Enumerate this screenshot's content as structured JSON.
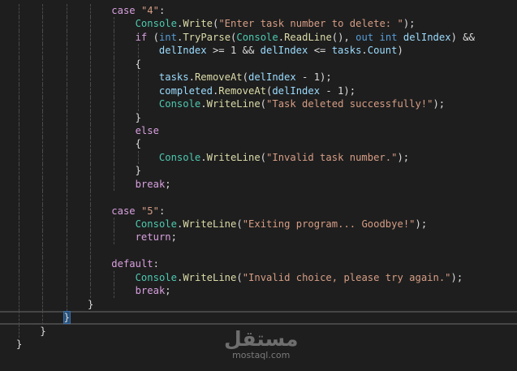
{
  "colors": {
    "background": "#1e1e1e",
    "keyword": "#d8a0df",
    "type_keyword": "#569cd6",
    "class": "#4ec9b0",
    "method": "#dcdcaa",
    "variable": "#9cdcfe",
    "string": "#d69d85"
  },
  "lines": [
    {
      "indent": 16,
      "tokens": [
        [
          "kw",
          "case"
        ],
        [
          "pun",
          " "
        ],
        [
          "str",
          "\"4\""
        ],
        [
          "pun",
          ":"
        ]
      ]
    },
    {
      "indent": 20,
      "tokens": [
        [
          "cls",
          "Console"
        ],
        [
          "pun",
          "."
        ],
        [
          "fn",
          "Write"
        ],
        [
          "pun",
          "("
        ],
        [
          "str",
          "\"Enter task number to delete: \""
        ],
        [
          "pun",
          ");"
        ]
      ]
    },
    {
      "indent": 20,
      "tokens": [
        [
          "kw",
          "if"
        ],
        [
          "pun",
          " ("
        ],
        [
          "kwb",
          "int"
        ],
        [
          "pun",
          "."
        ],
        [
          "fn",
          "TryParse"
        ],
        [
          "pun",
          "("
        ],
        [
          "cls",
          "Console"
        ],
        [
          "pun",
          "."
        ],
        [
          "fn",
          "ReadLine"
        ],
        [
          "pun",
          "(), "
        ],
        [
          "kwb",
          "out"
        ],
        [
          "pun",
          " "
        ],
        [
          "kwb",
          "int"
        ],
        [
          "pun",
          " "
        ],
        [
          "var",
          "delIndex"
        ],
        [
          "pun",
          ") &&"
        ]
      ]
    },
    {
      "indent": 24,
      "tokens": [
        [
          "var",
          "delIndex"
        ],
        [
          "pun",
          " >= 1 && "
        ],
        [
          "var",
          "delIndex"
        ],
        [
          "pun",
          " <= "
        ],
        [
          "var",
          "tasks"
        ],
        [
          "pun",
          "."
        ],
        [
          "var",
          "Count"
        ],
        [
          "pun",
          ")"
        ]
      ]
    },
    {
      "indent": 20,
      "tokens": [
        [
          "pun",
          "{"
        ]
      ]
    },
    {
      "indent": 24,
      "tokens": [
        [
          "var",
          "tasks"
        ],
        [
          "pun",
          "."
        ],
        [
          "fn",
          "RemoveAt"
        ],
        [
          "pun",
          "("
        ],
        [
          "var",
          "delIndex"
        ],
        [
          "pun",
          " - 1);"
        ]
      ]
    },
    {
      "indent": 24,
      "tokens": [
        [
          "var",
          "completed"
        ],
        [
          "pun",
          "."
        ],
        [
          "fn",
          "RemoveAt"
        ],
        [
          "pun",
          "("
        ],
        [
          "var",
          "delIndex"
        ],
        [
          "pun",
          " - 1);"
        ]
      ]
    },
    {
      "indent": 24,
      "tokens": [
        [
          "cls",
          "Console"
        ],
        [
          "pun",
          "."
        ],
        [
          "fn",
          "WriteLine"
        ],
        [
          "pun",
          "("
        ],
        [
          "str",
          "\"Task deleted successfully!\""
        ],
        [
          "pun",
          ");"
        ]
      ]
    },
    {
      "indent": 20,
      "tokens": [
        [
          "pun",
          "}"
        ]
      ]
    },
    {
      "indent": 20,
      "tokens": [
        [
          "kw",
          "else"
        ]
      ]
    },
    {
      "indent": 20,
      "tokens": [
        [
          "pun",
          "{"
        ]
      ]
    },
    {
      "indent": 24,
      "tokens": [
        [
          "cls",
          "Console"
        ],
        [
          "pun",
          "."
        ],
        [
          "fn",
          "WriteLine"
        ],
        [
          "pun",
          "("
        ],
        [
          "str",
          "\"Invalid task number.\""
        ],
        [
          "pun",
          ");"
        ]
      ]
    },
    {
      "indent": 20,
      "tokens": [
        [
          "pun",
          "}"
        ]
      ]
    },
    {
      "indent": 20,
      "tokens": [
        [
          "kw",
          "break"
        ],
        [
          "pun",
          ";"
        ]
      ]
    },
    {
      "indent": 16,
      "tokens": []
    },
    {
      "indent": 16,
      "tokens": [
        [
          "kw",
          "case"
        ],
        [
          "pun",
          " "
        ],
        [
          "str",
          "\"5\""
        ],
        [
          "pun",
          ":"
        ]
      ]
    },
    {
      "indent": 20,
      "tokens": [
        [
          "cls",
          "Console"
        ],
        [
          "pun",
          "."
        ],
        [
          "fn",
          "WriteLine"
        ],
        [
          "pun",
          "("
        ],
        [
          "str",
          "\"Exiting program... Goodbye!\""
        ],
        [
          "pun",
          ");"
        ]
      ]
    },
    {
      "indent": 20,
      "tokens": [
        [
          "kw",
          "return"
        ],
        [
          "pun",
          ";"
        ]
      ]
    },
    {
      "indent": 16,
      "tokens": []
    },
    {
      "indent": 16,
      "tokens": [
        [
          "kw",
          "default"
        ],
        [
          "pun",
          ":"
        ]
      ]
    },
    {
      "indent": 20,
      "tokens": [
        [
          "cls",
          "Console"
        ],
        [
          "pun",
          "."
        ],
        [
          "fn",
          "WriteLine"
        ],
        [
          "pun",
          "("
        ],
        [
          "str",
          "\"Invalid choice, please try again.\""
        ],
        [
          "pun",
          ");"
        ]
      ]
    },
    {
      "indent": 20,
      "tokens": [
        [
          "kw",
          "break"
        ],
        [
          "pun",
          ";"
        ]
      ]
    },
    {
      "indent": 12,
      "tokens": [
        [
          "pun",
          "}"
        ]
      ]
    },
    {
      "indent": 8,
      "current": true,
      "tokens": [
        [
          "match",
          "}"
        ]
      ]
    },
    {
      "indent": 4,
      "tokens": [
        [
          "pun",
          "}"
        ]
      ]
    },
    {
      "indent": 0,
      "tokens": [
        [
          "pun",
          "}"
        ]
      ]
    }
  ],
  "watermark": {
    "arabic": "مستقل",
    "domain": "mostaql.com"
  }
}
